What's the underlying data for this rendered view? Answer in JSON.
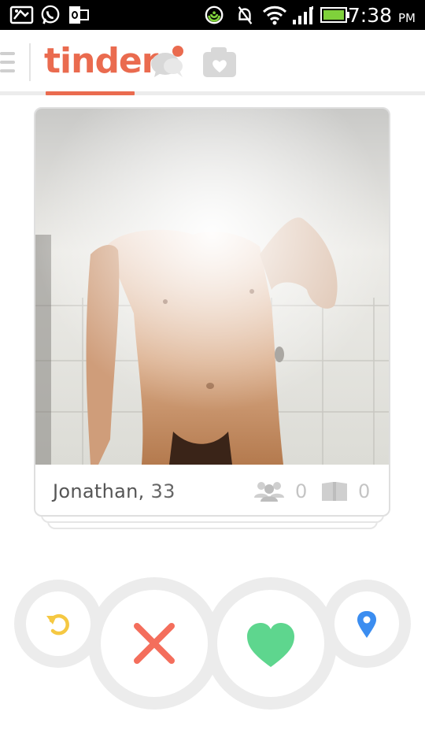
{
  "status_bar": {
    "time": "7:38",
    "ampm": "PM",
    "left_icons": [
      "screenshot-icon",
      "whatsapp-icon",
      "outlook-icon"
    ],
    "right_icons": [
      "sync-icon",
      "mute-icon",
      "wifi-icon",
      "signal-icon",
      "battery-icon"
    ]
  },
  "nav": {
    "logo": "tinder",
    "tabs": [
      "menu-icon",
      "tinder-logo",
      "chat-icon",
      "moments-icon"
    ],
    "active_tab": "tinder-logo",
    "accent": "#ea6b4f"
  },
  "card": {
    "name": "Jonathan,",
    "age": "33",
    "friends_count": "0",
    "interests_count": "0"
  },
  "actions": [
    {
      "name": "rewind-button",
      "icon": "rewind-icon",
      "color": "#f5c842"
    },
    {
      "name": "nope-button",
      "icon": "x-icon",
      "color": "#f46e5c"
    },
    {
      "name": "like-button",
      "icon": "heart-icon",
      "color": "#5ed68e"
    },
    {
      "name": "location-button",
      "icon": "location-pin-icon",
      "color": "#3b8df0"
    }
  ]
}
